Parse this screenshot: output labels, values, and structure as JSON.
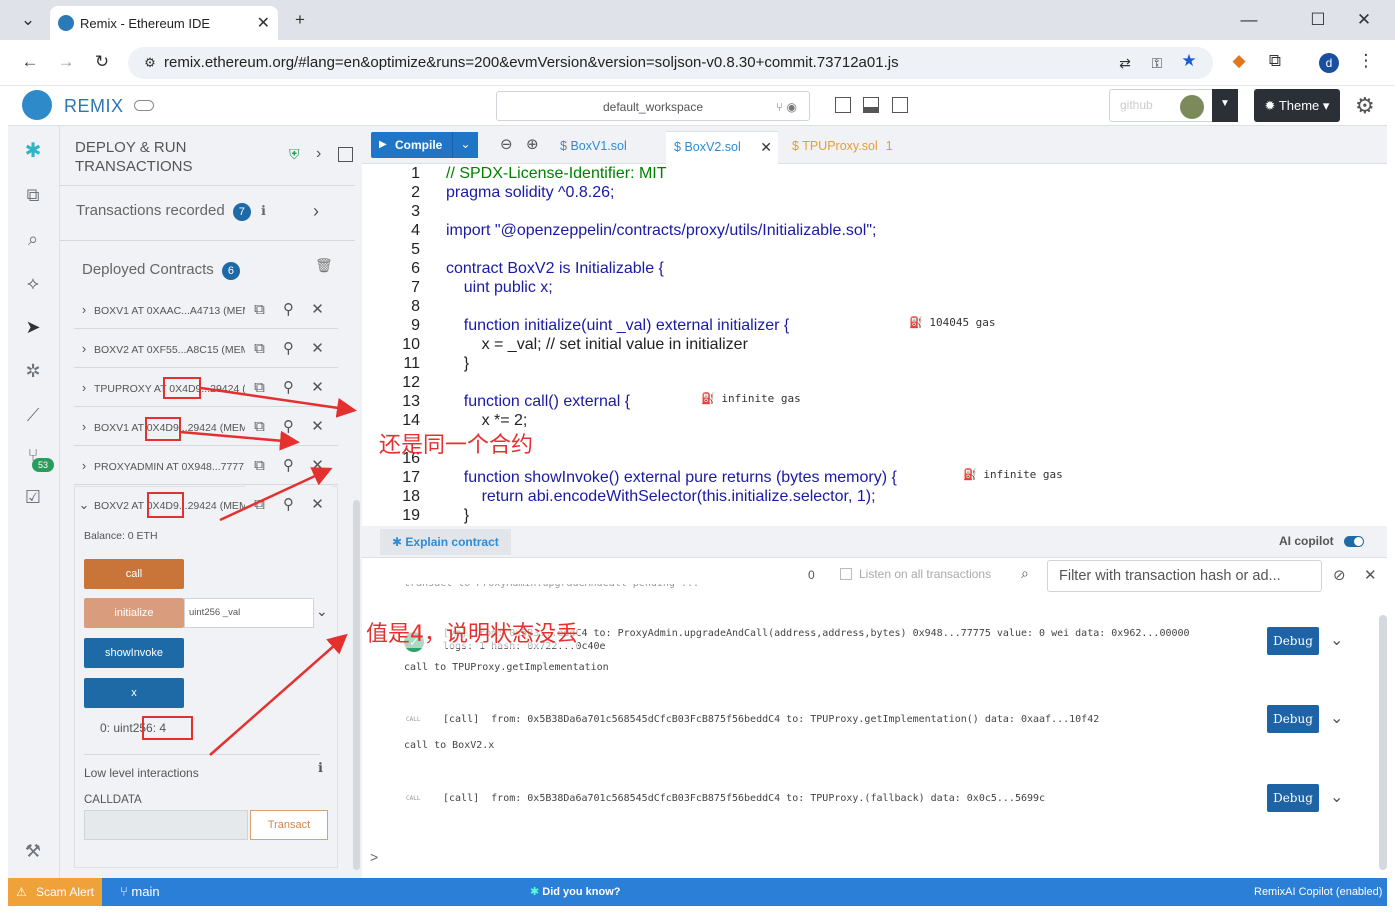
{
  "browser": {
    "tab_title": "Remix - Ethereum IDE",
    "url": "remix.ethereum.org/#lang=en&optimize&runs=200&evmVersion&version=soljson-v0.8.30+commit.73712a01.js",
    "profile_initial": "d"
  },
  "topbar": {
    "app_name": "REMIX",
    "workspace": "default_workspace",
    "theme_label": "Theme",
    "github_label": "github"
  },
  "sidepanel": {
    "title_line1": "DEPLOY & RUN",
    "title_line2": "TRANSACTIONS",
    "tx_recorded_label": "Transactions recorded",
    "tx_recorded_count": "7",
    "deployed_label": "Deployed Contracts",
    "deployed_count": "6",
    "contracts": [
      {
        "label": "BOXV1 AT 0XAAC...A4713 (MEM"
      },
      {
        "label": "BOXV2 AT 0XF55...A8C15 (MEM"
      },
      {
        "label": "TPUPROXY AT 0X4D9...29424 (M"
      },
      {
        "label": "BOXV1 AT 0X4D9...29424 (MEM"
      },
      {
        "label": "PROXYADMIN AT 0X948...7777!"
      },
      {
        "label": "BOXV2 AT 0X4D9...29424 (MEM"
      }
    ],
    "balance": "Balance: 0 ETH",
    "functions": {
      "call": "call",
      "initialize": "initialize",
      "initialize_placeholder": "uint256 _val",
      "showinvoke": "showInvoke",
      "x": "x"
    },
    "x_result": "0: uint256: 4",
    "low_level": "Low level interactions",
    "calldata": "CALLDATA",
    "transact": "Transact"
  },
  "editor": {
    "compile_label": "Compile",
    "tabs": [
      "BoxV1.sol",
      "BoxV2.sol",
      "TPUProxy.sol"
    ],
    "tpu_badge": "1",
    "lines": [
      {
        "n": "1",
        "t": "// SPDX-License-Identifier: MIT"
      },
      {
        "n": "2",
        "t": "pragma solidity ^0.8.26;"
      },
      {
        "n": "3",
        "t": ""
      },
      {
        "n": "4",
        "t": "import \"@openzeppelin/contracts/proxy/utils/Initializable.sol\";"
      },
      {
        "n": "5",
        "t": ""
      },
      {
        "n": "6",
        "t": "contract BoxV2 is Initializable {"
      },
      {
        "n": "7",
        "t": "    uint public x;"
      },
      {
        "n": "8",
        "t": ""
      },
      {
        "n": "9",
        "t": "    function initialize(uint _val) external initializer {"
      },
      {
        "n": "10",
        "t": "        x = _val; // set initial value in initializer"
      },
      {
        "n": "11",
        "t": "    }"
      },
      {
        "n": "12",
        "t": ""
      },
      {
        "n": "13",
        "t": "    function call() external {"
      },
      {
        "n": "14",
        "t": "        x *= 2;"
      },
      {
        "n": "16",
        "t": ""
      },
      {
        "n": "17",
        "t": "    function showInvoke() external pure returns (bytes memory) {"
      },
      {
        "n": "18",
        "t": "        return abi.encodeWithSelector(this.initialize.selector, 1);"
      },
      {
        "n": "19",
        "t": "    }"
      }
    ],
    "gas_9": "104045 gas",
    "gas_13": "infinite gas",
    "gas_17": "infinite gas"
  },
  "explain": {
    "label": "Explain contract",
    "ai_copilot": "AI copilot"
  },
  "terminal": {
    "count": "0",
    "listen_label": "Listen on all transactions",
    "filter_placeholder": "Filter with transaction hash or ad...",
    "top_cut": "transact to ProxyAdmin.upgradeAndCall pending ...",
    "log1_a": "[vm] from: 0x5B3...eddC4 to: ProxyAdmin.upgradeAndCall(address,address,bytes) 0x948...77775 value: 0 wei data: 0x962...00000",
    "log1_b": "logs: 1 hash: 0x722...0c40e",
    "log1_c": "call to TPUProxy.getImplementation",
    "log2_a": "[call]  from: 0x5B38Da6a701c568545dCfcB03FcB875f56beddC4 to: TPUProxy.getImplementation() data: 0xaaf...10f42",
    "log2_b": "call to BoxV2.x",
    "log3_a": "[call]  from: 0x5B38Da6a701c568545dCfcB03FcB875f56beddC4 to: TPUProxy.(fallback) data: 0x0c5...5699c",
    "call_tag": "CALL",
    "debug": "Debug",
    "prompt": ">"
  },
  "statusbar": {
    "scam": "Scam Alert",
    "branch": "main",
    "did_you_know": "Did you know?",
    "copilot": "RemixAI Copilot (enabled)"
  },
  "annotations": {
    "same_contract": "还是同一个合约",
    "value_four": "值是4，说明状态没丢"
  },
  "colors": {
    "accent": "#2075c7",
    "call_btn": "#c97539",
    "initialize_btn": "#d99d7e",
    "blue_btn": "#1e6aa6",
    "annotation": "#e53030"
  }
}
